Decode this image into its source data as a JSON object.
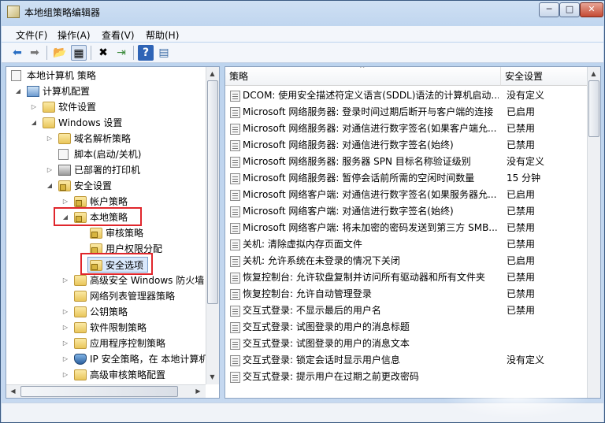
{
  "window": {
    "title": "本地组策略编辑器",
    "min_glyph": "─",
    "max_glyph": "□",
    "close_glyph": "✕"
  },
  "menu": [
    {
      "label": "文件(F)"
    },
    {
      "label": "操作(A)"
    },
    {
      "label": "查看(V)"
    },
    {
      "label": "帮助(H)"
    }
  ],
  "toolbar": {
    "back_glyph": "⬅",
    "forward_glyph": "➡",
    "up_glyph": "📂",
    "show_hide_glyph": "▦",
    "delete_glyph": "✖",
    "export_glyph": "⇥",
    "help_glyph": "?",
    "properties_glyph": "▤"
  },
  "tree": {
    "root": "本地计算机 策略",
    "items": [
      {
        "label": "计算机配置"
      },
      {
        "label": "软件设置"
      },
      {
        "label": "Windows 设置"
      },
      {
        "label": "域名解析策略"
      },
      {
        "label": "脚本(启动/关机)"
      },
      {
        "label": "已部署的打印机"
      },
      {
        "label": "安全设置"
      },
      {
        "label": "帐户策略"
      },
      {
        "label": "本地策略"
      },
      {
        "label": "审核策略"
      },
      {
        "label": "用户权限分配"
      },
      {
        "label": "安全选项"
      },
      {
        "label": "高级安全 Windows 防火墙"
      },
      {
        "label": "网络列表管理器策略"
      },
      {
        "label": "公钥策略"
      },
      {
        "label": "软件限制策略"
      },
      {
        "label": "应用程序控制策略"
      },
      {
        "label": "IP 安全策略，在 本地计算机"
      },
      {
        "label": "高级审核策略配置"
      }
    ]
  },
  "list": {
    "col_policy": "策略",
    "col_setting": "安全设置",
    "rows": [
      {
        "name": "DCOM: 使用安全描述符定义语言(SDDL)语法的计算机启动...",
        "setting": "没有定义"
      },
      {
        "name": "Microsoft 网络服务器: 登录时间过期后断开与客户端的连接",
        "setting": "已启用"
      },
      {
        "name": "Microsoft 网络服务器: 对通信进行数字签名(如果客户端允...",
        "setting": "已禁用"
      },
      {
        "name": "Microsoft 网络服务器: 对通信进行数字签名(始终)",
        "setting": "已禁用"
      },
      {
        "name": "Microsoft 网络服务器: 服务器 SPN 目标名称验证级别",
        "setting": "没有定义"
      },
      {
        "name": "Microsoft 网络服务器: 暂停会话前所需的空闲时间数量",
        "setting": "15 分钟"
      },
      {
        "name": "Microsoft 网络客户端: 对通信进行数字签名(如果服务器允...",
        "setting": "已启用"
      },
      {
        "name": "Microsoft 网络客户端: 对通信进行数字签名(始终)",
        "setting": "已禁用"
      },
      {
        "name": "Microsoft 网络客户端: 将未加密的密码发送到第三方 SMB...",
        "setting": "已禁用"
      },
      {
        "name": "关机: 清除虚拟内存页面文件",
        "setting": "已禁用"
      },
      {
        "name": "关机: 允许系统在未登录的情况下关闭",
        "setting": "已启用"
      },
      {
        "name": "恢复控制台: 允许软盘复制并访问所有驱动器和所有文件夹",
        "setting": "已禁用"
      },
      {
        "name": "恢复控制台: 允许自动管理登录",
        "setting": "已禁用"
      },
      {
        "name": "交互式登录: 不显示最后的用户名",
        "setting": "已禁用"
      },
      {
        "name": "交互式登录: 试图登录的用户的消息标题",
        "setting": ""
      },
      {
        "name": "交互式登录: 试图登录的用户的消息文本",
        "setting": ""
      },
      {
        "name": "交互式登录: 锁定会话时显示用户信息",
        "setting": "没有定义"
      },
      {
        "name": "交互式登录: 提示用户在过期之前更改密码",
        "setting": ""
      }
    ]
  }
}
